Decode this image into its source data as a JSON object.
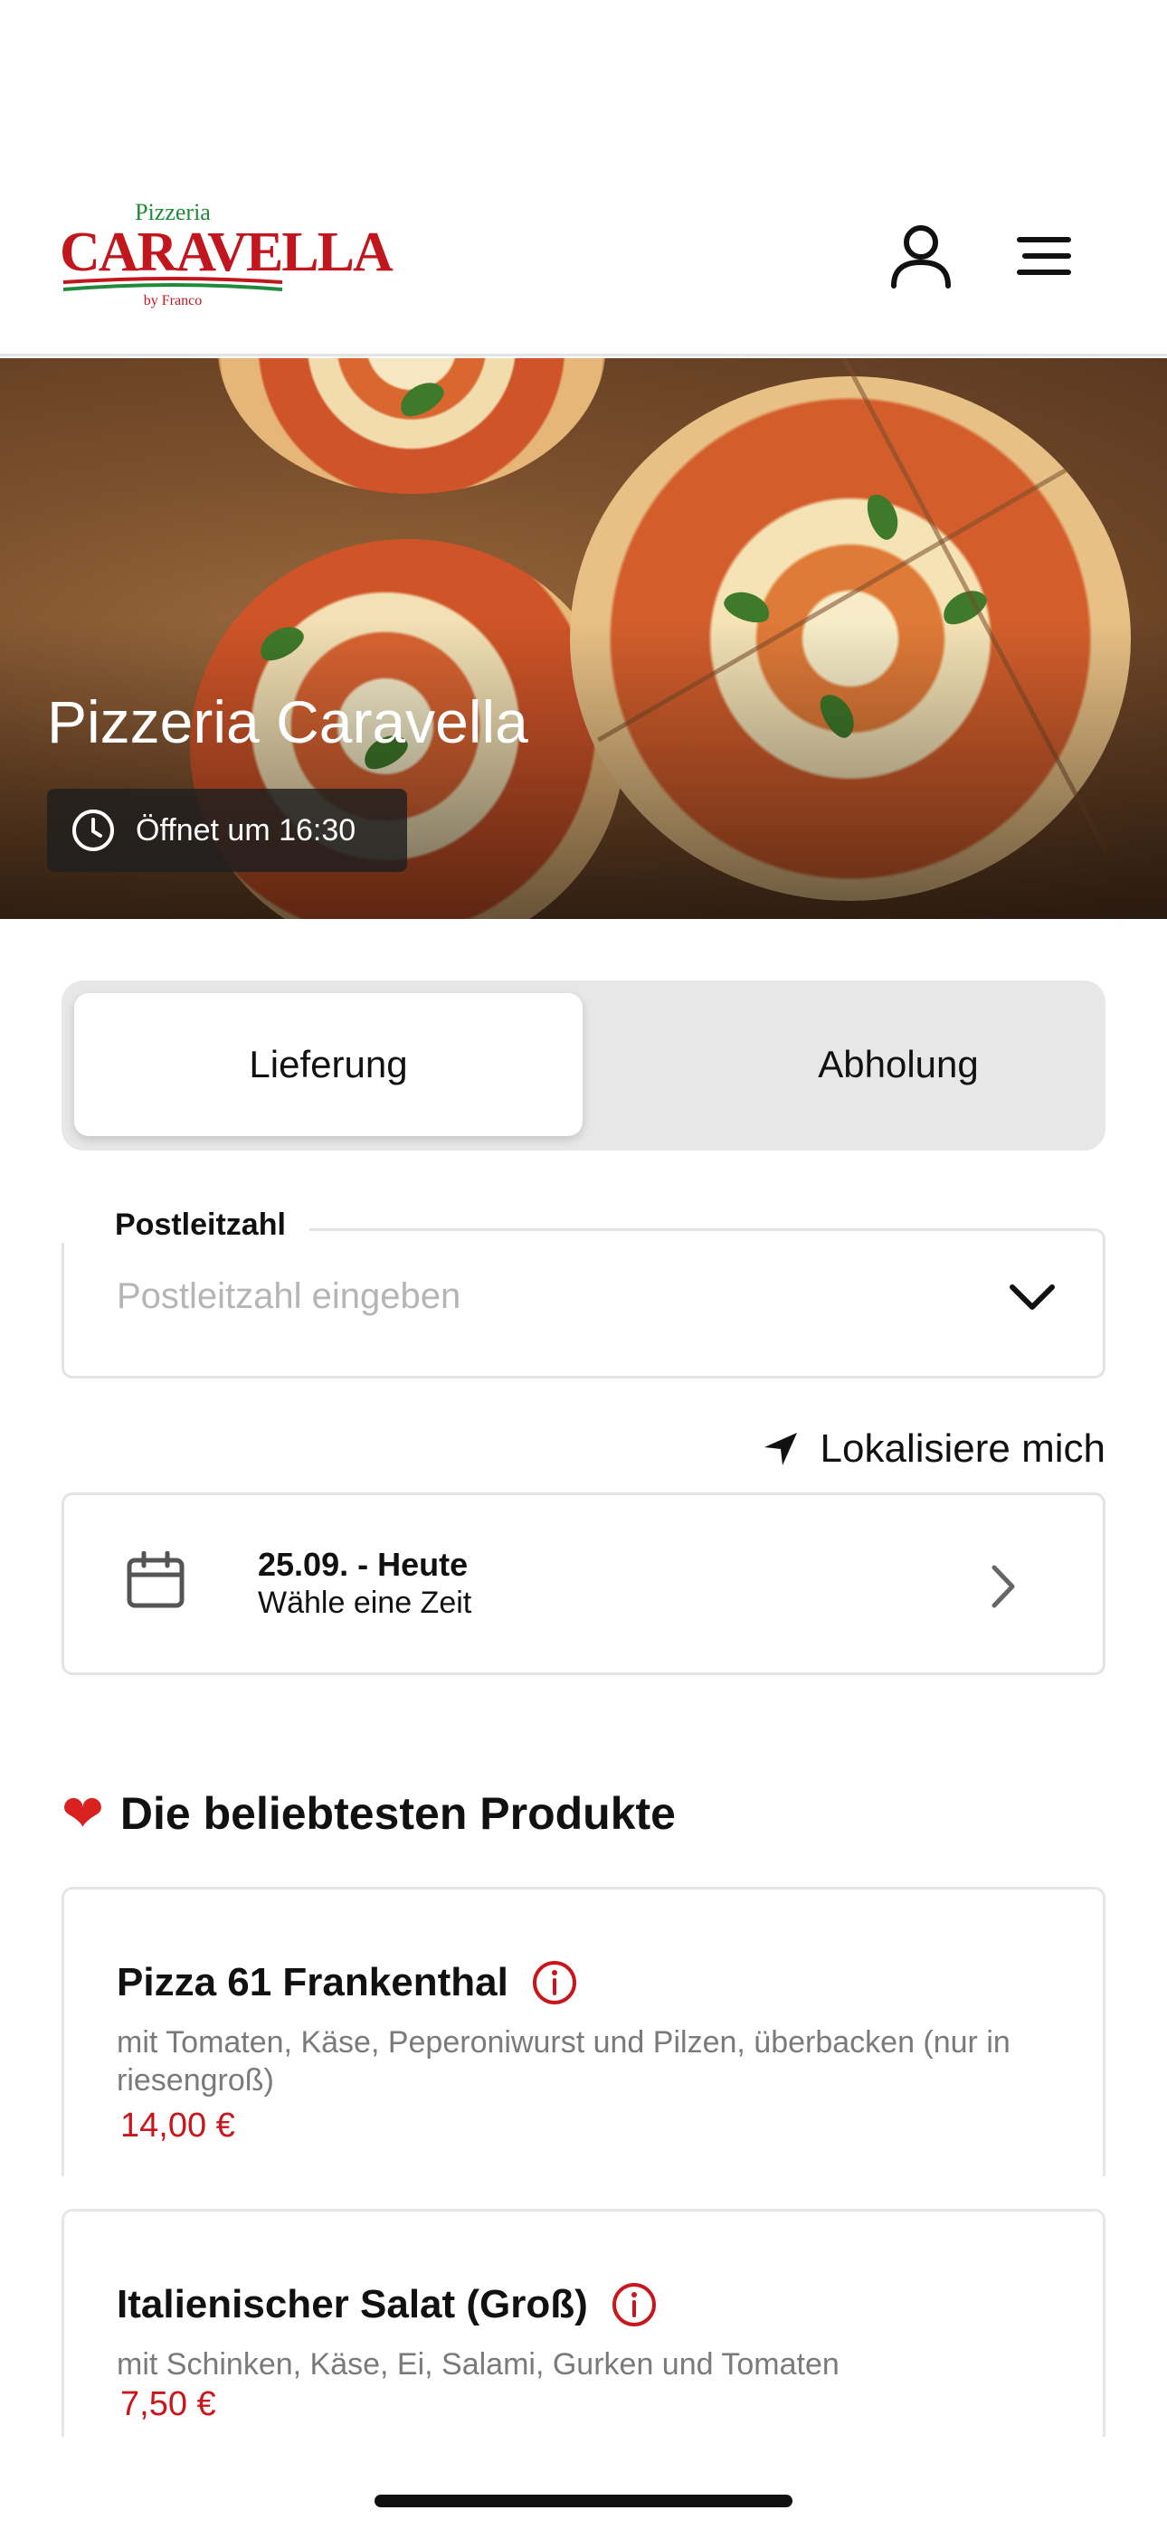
{
  "header": {
    "logo": {
      "top_text": "Pizzeria",
      "main_text": "CARAVELLA",
      "sub_text": "by Franco"
    },
    "icons": {
      "account": "user-icon",
      "menu": "hamburger-menu-icon"
    }
  },
  "hero": {
    "title": "Pizzeria Caravella",
    "opening_text": "Öffnet um 16:30",
    "opening_icon": "clock-icon"
  },
  "order_mode": {
    "options": [
      "Lieferung",
      "Abholung"
    ],
    "selected": "Lieferung"
  },
  "postcode": {
    "label": "Postleitzahl",
    "placeholder": "Postleitzahl eingeben",
    "value": ""
  },
  "locate": {
    "label": "Lokalisiere mich",
    "icon": "location-arrow-icon"
  },
  "date_picker": {
    "date": "25.09. - Heute",
    "hint": "Wähle eine Zeit",
    "icon": "calendar-icon"
  },
  "popular": {
    "title": "Die beliebtesten Produkte",
    "products": [
      {
        "name": "Pizza 61 Frankenthal",
        "description": "mit Tomaten, Käse, Peperoniwurst und Pilzen, überbacken (nur in riesengroß)",
        "price": "14,00 €"
      },
      {
        "name": "Italienischer Salat (Groß)",
        "description": "mit Schinken, Käse, Ei, Salami, Gurken und Tomaten",
        "price": "7,50 €"
      }
    ]
  },
  "colors": {
    "brand_red": "#c8161b",
    "brand_green": "#1f8a3a",
    "segment_bg": "#e7e7e7"
  }
}
